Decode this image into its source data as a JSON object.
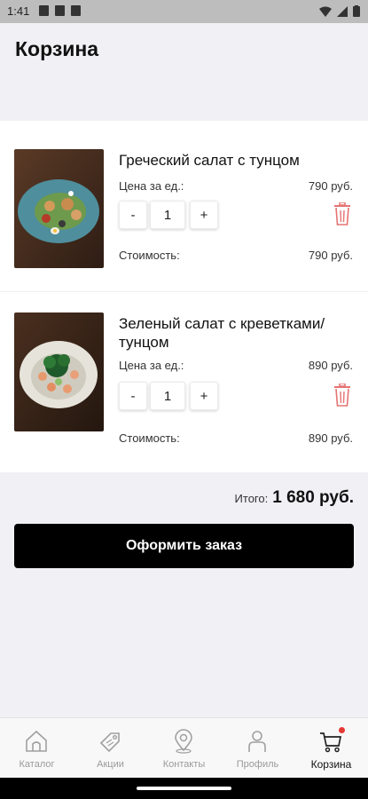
{
  "status_bar": {
    "time": "1:41"
  },
  "header": {
    "title": "Корзина"
  },
  "cart": {
    "items": [
      {
        "name": "Греческий салат с тунцом",
        "price_label": "Цена за ед.:",
        "price": "790 руб.",
        "quantity": "1",
        "minus": "-",
        "plus": "+",
        "cost_label": "Стоимость:",
        "cost": "790 руб."
      },
      {
        "name": "Зеленый салат с креветками/тунцом",
        "price_label": "Цена за ед.:",
        "price": "890 руб.",
        "quantity": "1",
        "minus": "-",
        "plus": "+",
        "cost_label": "Стоимость:",
        "cost": "890 руб."
      }
    ]
  },
  "summary": {
    "total_label": "Итого:",
    "total_value": "1 680 руб."
  },
  "checkout": {
    "label": "Оформить заказ"
  },
  "tabs": [
    {
      "label": "Каталог",
      "icon": "home-icon"
    },
    {
      "label": "Акции",
      "icon": "tag-icon"
    },
    {
      "label": "Контакты",
      "icon": "location-pin-icon"
    },
    {
      "label": "Профиль",
      "icon": "user-icon"
    },
    {
      "label": "Корзина",
      "icon": "cart-icon",
      "active": true
    }
  ],
  "colors": {
    "accent": "#000000",
    "badge": "#e53935",
    "delete": "#e57373",
    "background": "#f1f0f5"
  }
}
